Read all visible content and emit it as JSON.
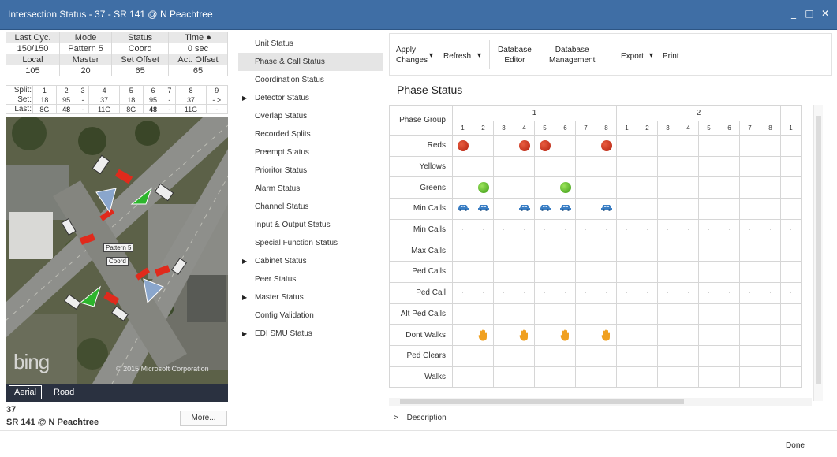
{
  "window": {
    "title": "Intersection Status - 37 - SR 141 @ N Peachtree",
    "minimize": "_",
    "maximize": "□",
    "close": "✕"
  },
  "status": {
    "row1_headers": [
      "Last Cyc.",
      "Mode",
      "Status",
      "Time ●"
    ],
    "row1_values": [
      "150/150",
      "Pattern 5",
      "Coord",
      "0 sec"
    ],
    "row2_headers": [
      "Local",
      "Master",
      "Set Offset",
      "Act. Offset"
    ],
    "row2_values": [
      "105",
      "20",
      "65",
      "65"
    ],
    "split_label": "Split:",
    "split_nums": [
      "1",
      "2",
      "3",
      "4",
      "5",
      "6",
      "7",
      "8",
      "9"
    ],
    "set_label": "Set:",
    "set_values": [
      "18",
      "95",
      "-",
      "37",
      "18",
      "95",
      "-",
      "37",
      "- >"
    ],
    "last_label": "Last:",
    "last_values": [
      "8G",
      "48",
      "-",
      "11G",
      "8G",
      "48",
      "-",
      "11G",
      "-"
    ]
  },
  "map": {
    "pattern_label": "Pattern 5",
    "coord_label": "Coord",
    "bing_logo": "bing",
    "copyright": "© 2015 Microsoft Corporation",
    "tabs": [
      "Aerial",
      "Road"
    ]
  },
  "intersection": {
    "id": "37",
    "name": "SR 141 @ N Peachtree",
    "more_label": "More..."
  },
  "nav": [
    {
      "label": "Unit Status",
      "expandable": false,
      "selected": false
    },
    {
      "label": "Phase & Call Status",
      "expandable": false,
      "selected": true
    },
    {
      "label": "Coordination Status",
      "expandable": false,
      "selected": false
    },
    {
      "label": "Detector Status",
      "expandable": true,
      "selected": false
    },
    {
      "label": "Overlap Status",
      "expandable": false,
      "selected": false
    },
    {
      "label": "Recorded Splits",
      "expandable": false,
      "selected": false
    },
    {
      "label": "Preempt Status",
      "expandable": false,
      "selected": false
    },
    {
      "label": "Prioritor Status",
      "expandable": false,
      "selected": false
    },
    {
      "label": "Alarm Status",
      "expandable": false,
      "selected": false
    },
    {
      "label": "Channel Status",
      "expandable": false,
      "selected": false
    },
    {
      "label": "Input & Output Status",
      "expandable": false,
      "selected": false
    },
    {
      "label": "Special Function Status",
      "expandable": false,
      "selected": false
    },
    {
      "label": "Cabinet Status",
      "expandable": true,
      "selected": false
    },
    {
      "label": "Peer Status",
      "expandable": false,
      "selected": false
    },
    {
      "label": "Master Status",
      "expandable": true,
      "selected": false
    },
    {
      "label": "Config Validation",
      "expandable": false,
      "selected": false
    },
    {
      "label": "EDI SMU Status",
      "expandable": true,
      "selected": false
    }
  ],
  "toolbar": {
    "apply_line1": "Apply",
    "apply_line2": "Changes",
    "refresh": "Refresh",
    "db_editor_line1": "Database",
    "db_editor_line2": "Editor",
    "db_mgmt_line1": "Database",
    "db_mgmt_line2": "Management",
    "export": "Export",
    "print": "Print",
    "dropdown_arrow": "▾"
  },
  "phase_status": {
    "title": "Phase Status",
    "group_label": "Phase Group",
    "groups": [
      "1",
      "2"
    ],
    "phases": [
      "1",
      "2",
      "3",
      "4",
      "5",
      "6",
      "7",
      "8",
      "1",
      "2",
      "3",
      "4",
      "5",
      "6",
      "7",
      "8",
      "1"
    ],
    "rows": [
      "Reds",
      "Yellows",
      "Greens",
      "Min Calls",
      "Min Calls",
      "Max Calls",
      "Ped Calls",
      "Ped Call",
      "Alt Ped Calls",
      "Dont Walks",
      "Ped Clears",
      "Walks"
    ],
    "reds_on": [
      1,
      4,
      5,
      8
    ],
    "greens_on": [
      2,
      6
    ],
    "vehicle_calls_on": [
      1,
      2,
      4,
      5,
      6,
      8
    ],
    "dont_walks_on": [
      2,
      4,
      6,
      8
    ],
    "dash_rows": [
      4,
      5,
      7
    ],
    "colors": {
      "red": "#c0280f",
      "green": "#4caf20",
      "vehicle": "#3a7ec4",
      "hand": "#f0a020"
    }
  },
  "footer": {
    "description_label": "Description",
    "description_arrow": ">",
    "done_label": "Done"
  }
}
